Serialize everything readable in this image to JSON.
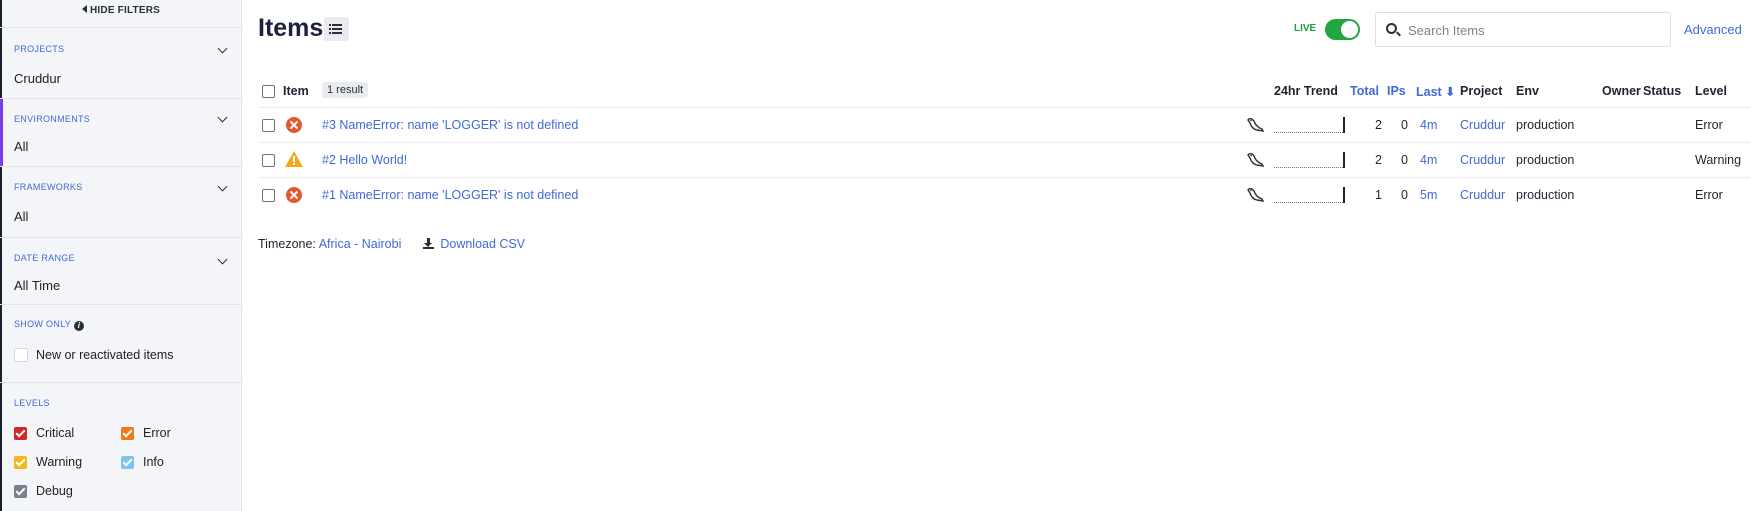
{
  "sidebar": {
    "hide_filters": "HIDE FILTERS",
    "projects": {
      "title": "PROJECTS",
      "value": "Cruddur"
    },
    "environments": {
      "title": "ENVIRONMENTS",
      "value": "All"
    },
    "frameworks": {
      "title": "FRAMEWORKS",
      "value": "All"
    },
    "date_range": {
      "title": "DATE RANGE",
      "value": "All Time"
    },
    "show_only": {
      "title": "SHOW ONLY",
      "option": "New or reactivated items",
      "checked": false
    },
    "levels": {
      "title": "LEVELS",
      "items": [
        {
          "label": "Critical",
          "color": "#d0262a",
          "checked": true
        },
        {
          "label": "Error",
          "color": "#f07a1a",
          "checked": true
        },
        {
          "label": "Warning",
          "color": "#f2b91a",
          "checked": true
        },
        {
          "label": "Info",
          "color": "#7fc4ec",
          "checked": true
        },
        {
          "label": "Debug",
          "color": "#7a818c",
          "checked": true
        }
      ]
    }
  },
  "header": {
    "title": "Items",
    "live_label": "LIVE",
    "live_on": true,
    "search_placeholder": "Search Items",
    "advanced_link": "Advanced"
  },
  "table": {
    "columns": {
      "item": "Item",
      "result_count": "1 result",
      "trend": "24hr Trend",
      "total": "Total",
      "ips": "IPs",
      "last": "Last ⬇",
      "project": "Project",
      "env": "Env",
      "owner": "Owner",
      "status": "Status",
      "level": "Level"
    },
    "rows": [
      {
        "title": "#3 NameError: name 'LOGGER' is not defined",
        "level_icon": "error-icon",
        "total": "2",
        "ips": "0",
        "last": "4m",
        "project": "Cruddur",
        "env": "production",
        "level": "Error"
      },
      {
        "title": "#2 Hello World!",
        "level_icon": "warning-icon",
        "total": "2",
        "ips": "0",
        "last": "4m",
        "project": "Cruddur",
        "env": "production",
        "level": "Warning"
      },
      {
        "title": "#1 NameError: name 'LOGGER' is not defined",
        "level_icon": "error-icon",
        "total": "1",
        "ips": "0",
        "last": "5m",
        "project": "Cruddur",
        "env": "production",
        "level": "Error"
      }
    ]
  },
  "footer": {
    "timezone_label": "Timezone:",
    "timezone_value": "Africa - Nairobi",
    "download_label": "Download CSV"
  }
}
